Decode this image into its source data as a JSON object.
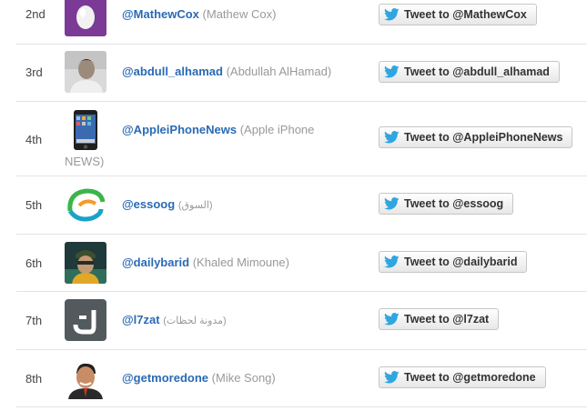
{
  "rows": [
    {
      "rank": "2nd",
      "handle": "@MathewCox",
      "name_line1": "(Mathew Cox)",
      "name_line2": "",
      "button": "Tweet to @MathewCox",
      "avatar": "egg-avatar-icon"
    },
    {
      "rank": "3rd",
      "handle": "@abdull_alhamad",
      "name_line1": "(Abdullah AlHamad)",
      "name_line2": "",
      "button": "Tweet to @abdull_alhamad",
      "avatar": "user-photo-avatar-icon"
    },
    {
      "rank": "4th",
      "handle": "@AppleiPhoneNews",
      "name_line1": "(Apple iPhone",
      "name_line2": "NEWS)",
      "button": "Tweet to @AppleiPhoneNews",
      "avatar": "iphone-avatar-icon"
    },
    {
      "rank": "5th",
      "handle": "@essoog",
      "name_line1": "(السوق)",
      "name_line2": "",
      "button": "Tweet to @essoog",
      "avatar": "essoog-logo-avatar-icon"
    },
    {
      "rank": "6th",
      "handle": "@dailybarid",
      "name_line1": "(Khaled Mimoune)",
      "name_line2": "",
      "button": "Tweet to @dailybarid",
      "avatar": "user-photo-avatar-icon"
    },
    {
      "rank": "7th",
      "handle": "@l7zat",
      "name_line1": "(مدونة لحظات)",
      "name_line2": "",
      "button": "Tweet to @l7zat",
      "avatar": "arabic-letter-avatar-icon"
    },
    {
      "rank": "8th",
      "handle": "@getmoredone",
      "name_line1": "(Mike Song)",
      "name_line2": "",
      "button": "Tweet to @getmoredone",
      "avatar": "user-photo-avatar-icon"
    }
  ],
  "colors": {
    "handle": "#2a6ab5",
    "name": "#999999",
    "twitter_bird": "#2fa6e0",
    "egg_bg": "#7b3a96"
  }
}
